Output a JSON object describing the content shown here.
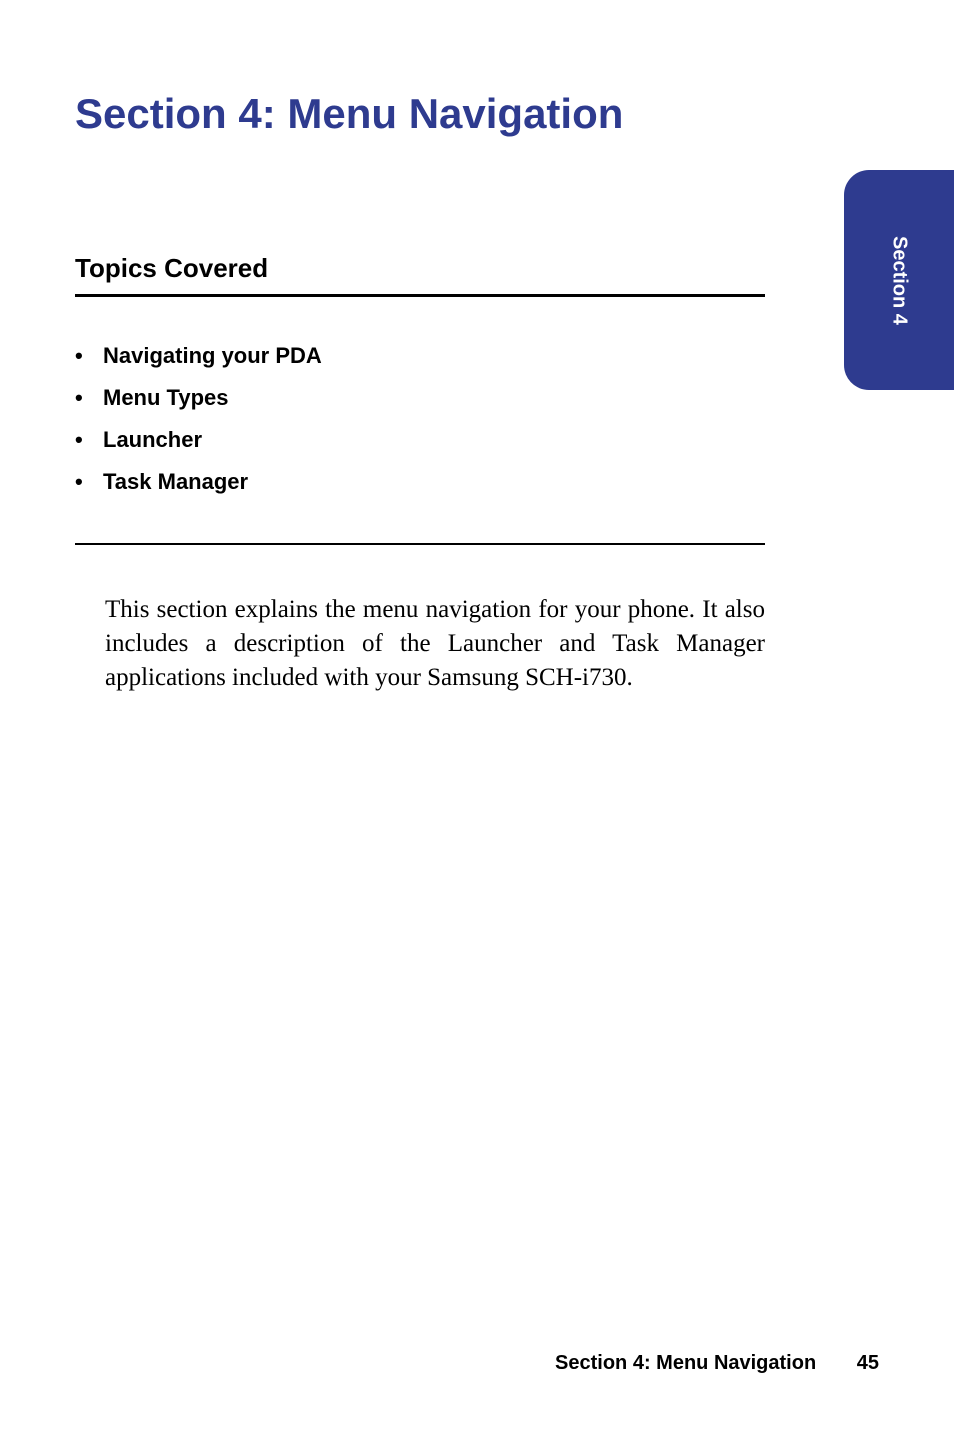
{
  "section_tab": {
    "label": "Section 4"
  },
  "main_title": "Section 4: Menu Navigation",
  "topics": {
    "heading": "Topics Covered",
    "items": [
      "Navigating your PDA",
      "Menu Types",
      "Launcher",
      "Task Manager"
    ]
  },
  "description": "This section explains the menu navigation for your phone. It also includes a description of the Launcher and Task Manager applications included with your Samsung SCH-i730.",
  "footer": {
    "section_label": "Section 4: Menu Navigation",
    "page_number": "45"
  }
}
